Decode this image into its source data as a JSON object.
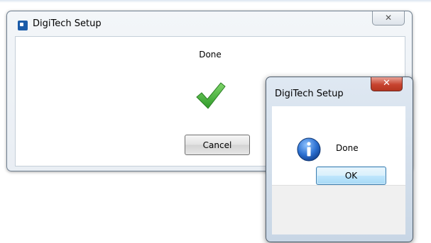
{
  "main_window": {
    "title": "DigiTech Setup",
    "close_glyph": "✕",
    "status_text": "Done",
    "status_icon": "checkmark-icon",
    "cancel_label": "Cancel"
  },
  "message_box": {
    "title": "DigiTech Setup",
    "close_glyph": "✕",
    "icon": "info-icon",
    "message": "Done",
    "ok_label": "OK"
  },
  "colors": {
    "check_green": "#4caf3a",
    "info_blue": "#1f5fbf",
    "close_red": "#c7442f",
    "ok_button_border": "#3c7fb1"
  }
}
